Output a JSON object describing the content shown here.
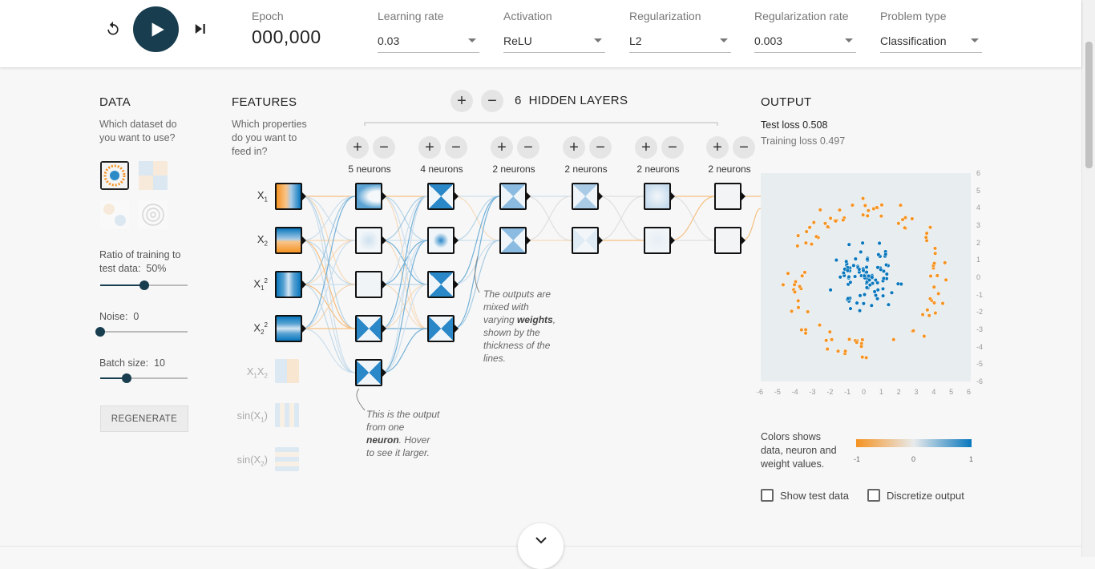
{
  "controls": {
    "epoch_label": "Epoch",
    "epoch_value": "000,000",
    "learning_rate_label": "Learning rate",
    "learning_rate_value": "0.03",
    "activation_label": "Activation",
    "activation_value": "ReLU",
    "regularization_label": "Regularization",
    "regularization_value": "L2",
    "regularization_rate_label": "Regularization rate",
    "regularization_rate_value": "0.003",
    "problem_type_label": "Problem type",
    "problem_type_value": "Classification"
  },
  "data_panel": {
    "title": "DATA",
    "subtitle_1": "Which dataset do",
    "subtitle_2": "you want to use?",
    "ratio_label_1": "Ratio of training to",
    "ratio_label_2": "test data:",
    "ratio_value": "50%",
    "ratio_fraction": 0.5,
    "noise_label": "Noise:",
    "noise_value": "0",
    "noise_fraction": 0,
    "batch_label": "Batch size:",
    "batch_value": "10",
    "batch_fraction": 0.3,
    "regenerate_label": "REGENERATE"
  },
  "features_panel": {
    "title": "FEATURES",
    "subtitle_1": "Which properties",
    "subtitle_2": "do you want to",
    "subtitle_3": "feed in?",
    "features": [
      {
        "base": "X",
        "sub": "1",
        "sup": ""
      },
      {
        "base": "X",
        "sub": "2",
        "sup": ""
      },
      {
        "base": "X",
        "sub": "1",
        "sup": "2"
      },
      {
        "base": "X",
        "sub": "2",
        "sup": "2"
      },
      {
        "base": "X",
        "sub": "1",
        "sup": "",
        "base2": "X",
        "sub2": "2"
      },
      {
        "base": "sin(X",
        "sub": "1",
        "tail": ")"
      },
      {
        "base": "sin(X",
        "sub": "2",
        "tail": ")"
      }
    ]
  },
  "network": {
    "layer_count": "6",
    "layers_title": "HIDDEN LAYERS",
    "plus_symbol": "+",
    "minus_symbol": "−",
    "layers": [
      {
        "label": "5 neurons"
      },
      {
        "label": "4 neurons"
      },
      {
        "label": "2 neurons"
      },
      {
        "label": "2 neurons"
      },
      {
        "label": "2 neurons"
      },
      {
        "label": "2 neurons"
      }
    ],
    "annotation_weights_1": "The outputs are",
    "annotation_weights_2": "mixed with",
    "annotation_weights_3": "varying",
    "annotation_weights_bold": "weights",
    "annotation_weights_4": "shown by the",
    "annotation_weights_5": "thickness of the",
    "annotation_weights_6": "lines.",
    "annotation_neuron_1": "This is the output",
    "annotation_neuron_2": "from one",
    "annotation_neuron_bold": "neuron",
    "annotation_neuron_3": ". Hover",
    "annotation_neuron_4": "to see it larger."
  },
  "output_panel": {
    "title": "OUTPUT",
    "test_loss_label": "Test loss",
    "test_loss_value": "0.508",
    "training_loss_label": "Training loss",
    "training_loss_value": "0.497",
    "legend_text_1": "Colors shows",
    "legend_text_2": "data, neuron and",
    "legend_text_3": "weight values.",
    "legend_min": "-1",
    "legend_mid": "0",
    "legend_max": "1",
    "show_test_label": "Show test data",
    "discretize_label": "Discretize output",
    "x_ticks": [
      "-6",
      "-5",
      "-4",
      "-3",
      "-2",
      "-1",
      "0",
      "1",
      "2",
      "3",
      "4",
      "5",
      "6"
    ],
    "y_ticks": [
      "6",
      "5",
      "4",
      "3",
      "2",
      "1",
      "0",
      "-1",
      "-2",
      "-3",
      "-4",
      "-5",
      "-6"
    ]
  },
  "colors": {
    "primary": "#183d4e",
    "orange": "#f59322",
    "blue": "#0877bd"
  }
}
